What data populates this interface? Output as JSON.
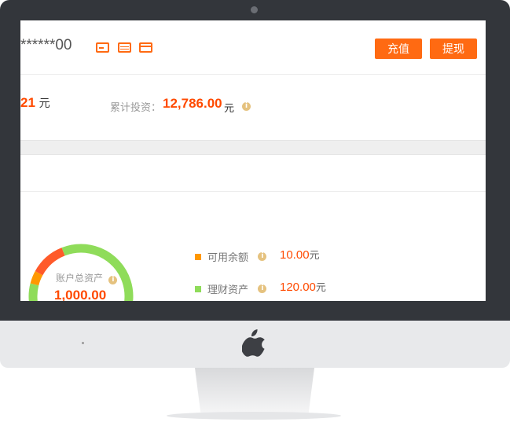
{
  "account": {
    "masked_number": "******00"
  },
  "buttons": {
    "recharge": "充值",
    "withdraw": "提现"
  },
  "summary": {
    "left_amount_partial": "21",
    "left_unit": "元",
    "investment_label": "累计投资：",
    "investment_amount": "12,786.00",
    "investment_unit": "元"
  },
  "assets": {
    "total_label": "账户总资产",
    "total_value": "1,000.00",
    "legend": [
      {
        "label": "可用余额",
        "value": "10.00",
        "unit": "元",
        "color": "#ff9800"
      },
      {
        "label": "理财资产",
        "value": "120.00",
        "unit": "元",
        "color": "#8fdc5a"
      }
    ]
  },
  "chart_data": {
    "type": "pie",
    "segments": [
      {
        "value": 0.79,
        "color": "#8fdc5a"
      },
      {
        "value": 0.04,
        "color": "#ff9800"
      },
      {
        "value": 0.11,
        "color": "#ff5a2a"
      },
      {
        "value": 0.06,
        "color": "#8fdc5a"
      }
    ]
  },
  "colors": {
    "accent": "#ff6a12",
    "amount": "#ff4a00"
  },
  "icons": [
    "card-icon",
    "card-icon",
    "card-icon",
    "info-icon",
    "apple-logo-icon"
  ]
}
